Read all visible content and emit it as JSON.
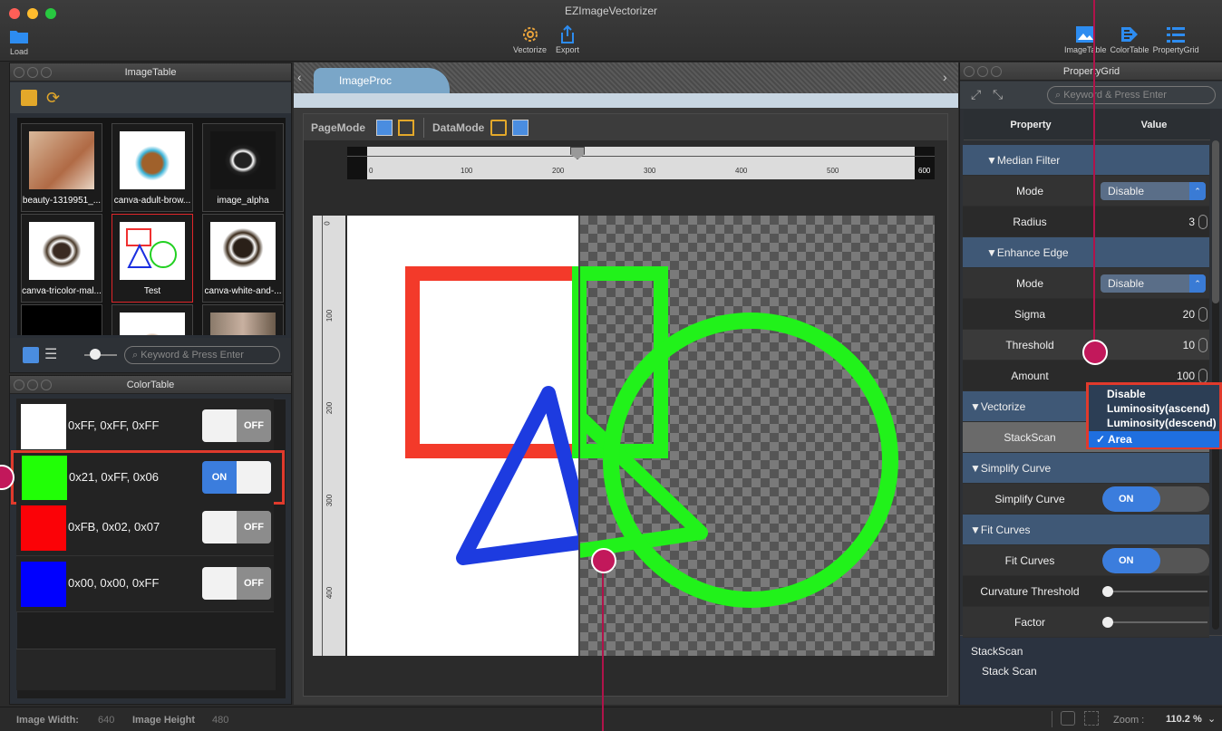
{
  "app": {
    "title": "EZImageVectorizer"
  },
  "toolbar": {
    "load": "Load",
    "vectorize": "Vectorize",
    "export": "Export",
    "imagetable": "ImageTable",
    "colortable": "ColorTable",
    "propertygrid": "PropertyGrid"
  },
  "image_table": {
    "title": "ImageTable",
    "thumbnails": [
      "beauty-1319951_...",
      "canva-adult-brow...",
      "image_alpha",
      "canva-tricolor-mal...",
      "Test",
      "canva-white-and-..."
    ],
    "search_placeholder": "Keyword & Press Enter"
  },
  "color_table": {
    "title": "ColorTable",
    "rows": [
      {
        "label": "0xFF, 0xFF, 0xFF",
        "color": "#ffffff",
        "state": "OFF"
      },
      {
        "label": "0x21, 0xFF, 0x06",
        "color": "#21ff06",
        "state": "ON"
      },
      {
        "label": "0xFB, 0x02, 0x07",
        "color": "#fb0207",
        "state": "OFF"
      },
      {
        "label": "0x00, 0x00, 0xFF",
        "color": "#0000ff",
        "state": "OFF"
      }
    ]
  },
  "image_proc": {
    "tab": "ImageProc",
    "page_mode": "PageMode",
    "data_mode": "DataMode",
    "ruler_top": [
      "0",
      "100",
      "200",
      "300",
      "400",
      "500",
      "600"
    ],
    "ruler_left": [
      "0",
      "100",
      "200",
      "300",
      "400"
    ]
  },
  "property_grid": {
    "title": "PropertyGrid",
    "search_placeholder": "Keyword & Press Enter",
    "col_property": "Property",
    "col_value": "Value",
    "median_filter": {
      "header": "▼Median Filter",
      "mode_label": "Mode",
      "mode_value": "Disable",
      "radius_label": "Radius",
      "radius_value": "3"
    },
    "enhance_edge": {
      "header": "▼Enhance Edge",
      "mode_label": "Mode",
      "mode_value": "Disable",
      "sigma_label": "Sigma",
      "sigma_value": "20",
      "threshold_label": "Threshold",
      "threshold_value": "10",
      "amount_label": "Amount",
      "amount_value": "100"
    },
    "vectorize": {
      "header": "▼Vectorize",
      "stackscan_label": "StackScan"
    },
    "simplify": {
      "header": "▼Simplify Curve",
      "label": "Simplify Curve",
      "value": "ON"
    },
    "fit": {
      "header": "▼Fit Curves",
      "label": "Fit Curves",
      "value": "ON",
      "curvature_label": "Curvature Threshold",
      "factor_label": "Factor"
    },
    "dropdown": {
      "options": [
        "Disable",
        "Luminosity(ascend)",
        "Luminosity(descend)",
        "Area"
      ],
      "selected": "✓ Area"
    },
    "help": {
      "title": "StackScan",
      "desc": "Stack Scan"
    }
  },
  "status": {
    "width_label": "Image Width:",
    "width_value": "640",
    "height_label": "Image Height",
    "height_value": "480",
    "zoom_label": "Zoom :",
    "zoom_value": "110.2 %"
  }
}
